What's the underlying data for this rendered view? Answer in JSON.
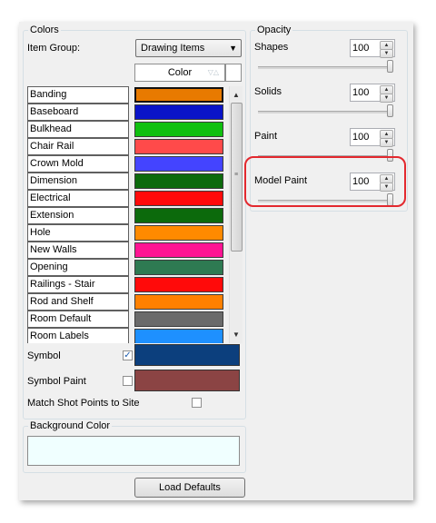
{
  "colors_group": {
    "title": "Colors",
    "item_group_label": "Item Group:",
    "item_group_value": "Drawing Items",
    "column_header": "Color",
    "rows": [
      {
        "name": "Banding",
        "color": "#e87a00",
        "selected": true
      },
      {
        "name": "Baseboard",
        "color": "#0a14c8"
      },
      {
        "name": "Bulkhead",
        "color": "#10c010"
      },
      {
        "name": "Chair Rail",
        "color": "#ff4a4a"
      },
      {
        "name": "Crown Mold",
        "color": "#4444ff"
      },
      {
        "name": "Dimension",
        "color": "#0c6a0c"
      },
      {
        "name": "Electrical",
        "color": "#ff0a0a"
      },
      {
        "name": "Extension",
        "color": "#0c6a0c"
      },
      {
        "name": "Hole",
        "color": "#ff8a00"
      },
      {
        "name": "New Walls",
        "color": "#ff1493"
      },
      {
        "name": "Opening",
        "color": "#2e7a52"
      },
      {
        "name": "Railings - Stair",
        "color": "#ff0a0a"
      },
      {
        "name": "Rod and Shelf",
        "color": "#ff8000"
      },
      {
        "name": "Room Default",
        "color": "#6a6a6a"
      },
      {
        "name": "Room Labels",
        "color": "#1e90ff"
      }
    ],
    "symbol_label": "Symbol",
    "symbol_checked": true,
    "symbol_color": "#0c3f7d",
    "symbol_paint_label": "Symbol Paint",
    "symbol_paint_checked": false,
    "symbol_paint_color": "#8b4444",
    "match_label": "Match Shot Points to Site",
    "match_checked": false
  },
  "background_group": {
    "title": "Background Color",
    "color": "#f0ffff"
  },
  "load_defaults_label": "Load Defaults",
  "opacity_group": {
    "title": "Opacity",
    "items": [
      {
        "label": "Shapes",
        "value": "100",
        "level": 1.0
      },
      {
        "label": "Solids",
        "value": "100",
        "level": 1.0
      },
      {
        "label": "Paint",
        "value": "100",
        "level": 1.0
      },
      {
        "label": "Model Paint",
        "value": "100",
        "level": 1.0
      }
    ]
  },
  "highlight_color": "#e3282e"
}
